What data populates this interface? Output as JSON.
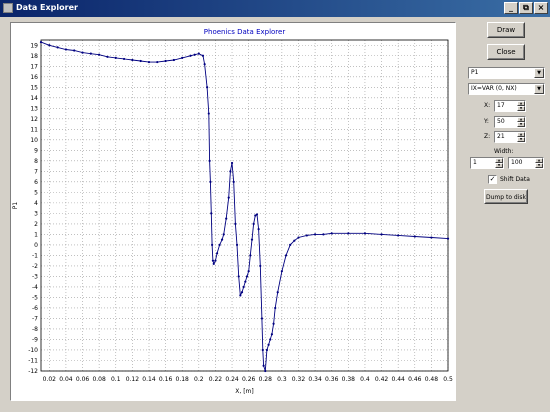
{
  "window": {
    "title": "Data Explorer",
    "buttons": {
      "minimize": "_",
      "maximize": "⧉",
      "close": "×"
    }
  },
  "controls": {
    "draw_label": "Draw",
    "close_label": "Close",
    "variable_select": "P1",
    "range_select": "IX=VAR (0, NX)",
    "x_label": "X:",
    "x_value": "17",
    "y_label": "Y:",
    "y_value": "50",
    "z_label": "Z:",
    "z_value": "21",
    "width_label": "Width:",
    "width_from": "1",
    "width_to": "100",
    "shift_data_label": "Shift Data",
    "shift_data_checked": true,
    "dump_label": "Dump to disk"
  },
  "chart_data": {
    "type": "line",
    "title": "Phoenics Data Explorer",
    "xlabel": "X, [m]",
    "ylabel": "P1",
    "xlim": [
      0.01,
      0.5
    ],
    "ylim": [
      -12,
      19.5
    ],
    "x_ticks": [
      "0.02",
      "0.04",
      "0.06",
      "0.08",
      "0.1",
      "0.12",
      "0.14",
      "0.16",
      "0.18",
      "0.2",
      "0.22",
      "0.24",
      "0.26",
      "0.28",
      "0.3",
      "0.32",
      "0.34",
      "0.36",
      "0.38",
      "0.4",
      "0.42",
      "0.44",
      "0.46",
      "0.48",
      "0.5"
    ],
    "y_ticks": [
      "19",
      "18",
      "17",
      "16",
      "15",
      "14",
      "13",
      "12",
      "11",
      "10",
      "9",
      "8",
      "7",
      "6",
      "5",
      "4",
      "3",
      "2",
      "1",
      "0",
      "-1",
      "-2",
      "-3",
      "-4",
      "-5",
      "-6",
      "-7",
      "-8",
      "-9",
      "-10",
      "-11",
      "-12"
    ],
    "grid": true,
    "line_color": "#000080",
    "series": [
      {
        "x": [
          0.01,
          0.02,
          0.03,
          0.04,
          0.05,
          0.06,
          0.07,
          0.08,
          0.09,
          0.1,
          0.11,
          0.12,
          0.13,
          0.14,
          0.15,
          0.16,
          0.17,
          0.18,
          0.19,
          0.195,
          0.2,
          0.205,
          0.207,
          0.21,
          0.212,
          0.213,
          0.214,
          0.215,
          0.216,
          0.217,
          0.218,
          0.22,
          0.222,
          0.225,
          0.228,
          0.23,
          0.233,
          0.236,
          0.238,
          0.24,
          0.242,
          0.244,
          0.246,
          0.248,
          0.25,
          0.252,
          0.254,
          0.256,
          0.258,
          0.26,
          0.262,
          0.264,
          0.266,
          0.268,
          0.27,
          0.272,
          0.274,
          0.276,
          0.277,
          0.278,
          0.28,
          0.282,
          0.284,
          0.286,
          0.288,
          0.29,
          0.292,
          0.295,
          0.3,
          0.305,
          0.31,
          0.315,
          0.32,
          0.33,
          0.34,
          0.35,
          0.36,
          0.38,
          0.4,
          0.42,
          0.44,
          0.46,
          0.48,
          0.5
        ],
        "y": [
          19.3,
          19.0,
          18.8,
          18.6,
          18.5,
          18.3,
          18.2,
          18.1,
          17.9,
          17.8,
          17.7,
          17.6,
          17.5,
          17.4,
          17.4,
          17.5,
          17.6,
          17.8,
          18.0,
          18.1,
          18.2,
          18.0,
          17.2,
          15.0,
          12.5,
          8.0,
          6.0,
          3.0,
          0.0,
          -1.5,
          -1.8,
          -1.5,
          -0.8,
          0.0,
          0.5,
          1.0,
          2.5,
          4.5,
          7.0,
          7.8,
          6.0,
          2.0,
          0.0,
          -3.0,
          -4.8,
          -4.5,
          -4.0,
          -3.5,
          -3.0,
          -2.5,
          -1.0,
          0.5,
          2.0,
          2.8,
          2.9,
          1.5,
          -2.0,
          -7.0,
          -10.0,
          -11.5,
          -12.0,
          -10.0,
          -9.5,
          -9.0,
          -8.5,
          -7.5,
          -6.0,
          -4.5,
          -2.5,
          -1.0,
          0.0,
          0.4,
          0.7,
          0.9,
          1.0,
          1.0,
          1.1,
          1.1,
          1.1,
          1.0,
          0.9,
          0.8,
          0.7,
          0.6
        ]
      }
    ]
  }
}
